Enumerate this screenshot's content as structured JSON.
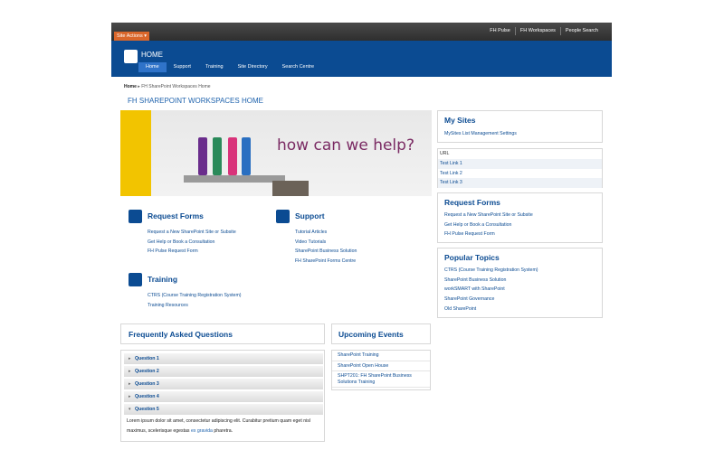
{
  "topbar": {
    "site_actions": "Site Actions ▾",
    "links": [
      "FH Pulse",
      "FH Workspaces",
      "People Search"
    ]
  },
  "header": {
    "title": "HOME",
    "nav": [
      "Home",
      "Support",
      "Training",
      "Site Directory",
      "Search Centre"
    ],
    "active_nav": "Home"
  },
  "breadcrumb": {
    "home": "Home",
    "sep": "▸",
    "current": "FH SharePoint Workspaces Home"
  },
  "page_title": "FH SHAREPOINT WORKSPACES HOME",
  "hero": {
    "caption": "how can we help?"
  },
  "request_forms": {
    "title": "Request Forms",
    "links": [
      "Request a New SharePoint Site or Subsite",
      "Get Help or Book a Consultation",
      "FH Pulse Request Form"
    ]
  },
  "support": {
    "title": "Support",
    "links": [
      "Tutorial Articles",
      "Video Tutorials",
      "SharePoint Business Solution",
      "FH SharePoint Forms Centre"
    ]
  },
  "training": {
    "title": "Training",
    "links": [
      "CTRS (Course Training Registration System)",
      "Training Resources"
    ]
  },
  "my_sites": {
    "title": "My Sites",
    "links": [
      "MySites List Management Settings"
    ]
  },
  "test_links": {
    "header": "URL",
    "links": [
      "Test Link 1",
      "Test Link 2",
      "Test Link 3"
    ]
  },
  "right_request_forms": {
    "title": "Request Forms",
    "links": [
      "Request a New SharePoint Site or Subsite",
      "Get Help or Book a Consultation",
      "FH Pulse Request Form"
    ]
  },
  "popular_topics": {
    "title": "Popular Topics",
    "links": [
      "CTRS (Course Training Registration System)",
      "SharePoint Business Solution",
      "workSMART with SharePoint",
      "SharePoint Governance",
      "Old SharePoint"
    ]
  },
  "faq": {
    "title": "Frequently Asked Questions",
    "questions": [
      "Question 1",
      "Question 2",
      "Question 3",
      "Question 4",
      "Question 5"
    ],
    "answer_pre": "Lorem ipsum dolor sit amet, consectetur adipiscing elit. Curabitur pretium quam eget nisl maximus, scelerisque egestas",
    "answer_link": "ex gravida",
    "answer_post": "pharetra."
  },
  "events": {
    "title": "Upcoming Events",
    "items": [
      "SharePoint Training",
      "SharePoint Open House",
      "SHPT201: FH SharePoint Business Solutions Training"
    ]
  },
  "colors": {
    "brand_blue": "#0b4b92",
    "site_actions_orange": "#d9662a",
    "hero_yellow": "#f2c400"
  },
  "icons": [
    "square-tile-icon",
    "expand-arrow-icon",
    "collapse-arrow-icon"
  ]
}
